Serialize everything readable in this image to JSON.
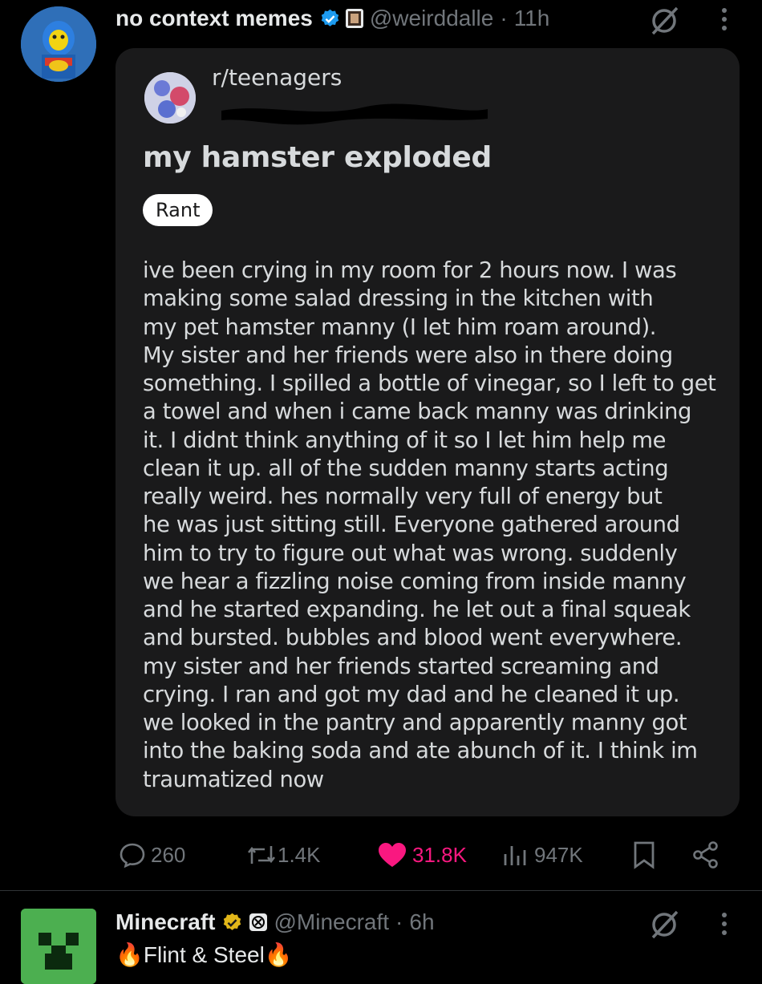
{
  "tweet": {
    "display_name": "no context memes",
    "handle": "@weirddalle",
    "separator": "·",
    "time": "11h",
    "icons": {
      "verified": "verified-badge-icon",
      "affiliate": "affiliate-badge-icon",
      "grok": "grok-icon",
      "more": "more-options-icon"
    }
  },
  "reddit_post": {
    "subreddit": "r/teenagers",
    "title": "my hamster exploded",
    "flair": "Rant",
    "body_lines": [
      "ive been crying in my room for 2 hours now. I was",
      "making some salad dressing in the kitchen with",
      "my pet hamster manny (I let him roam around).",
      "My sister and her friends were also in there doing",
      "something. I spilled a bottle of vinegar, so I left to get",
      "a towel and when i came back manny was drinking",
      "it. I didnt think anything of it so I let him help me",
      "clean it up. all of the sudden manny starts acting",
      "really weird. hes normally very full of energy but",
      "he was just sitting still. Everyone gathered around",
      "him to try to figure out what was wrong. suddenly",
      "we hear a fizzling noise coming from inside manny",
      "and he started expanding. he let out a final squeak",
      "and bursted. bubbles and blood went everywhere.",
      "my sister and her friends started screaming and",
      "crying. I ran and got my dad and he cleaned it up.",
      "we looked in the pantry and apparently manny got",
      "into the baking soda and ate abunch of it. I think im",
      "traumatized now"
    ]
  },
  "actions": {
    "replies": "260",
    "reposts": "1.4K",
    "likes": "31.8K",
    "views": "947K",
    "colors": {
      "muted": "#71767b",
      "like": "#f91880"
    }
  },
  "next_tweet": {
    "display_name": "Minecraft",
    "handle": "@Minecraft",
    "separator": "·",
    "time": "6h",
    "text_prefix": "🔥",
    "text": "Flint & Steel",
    "text_suffix": "🔥"
  }
}
